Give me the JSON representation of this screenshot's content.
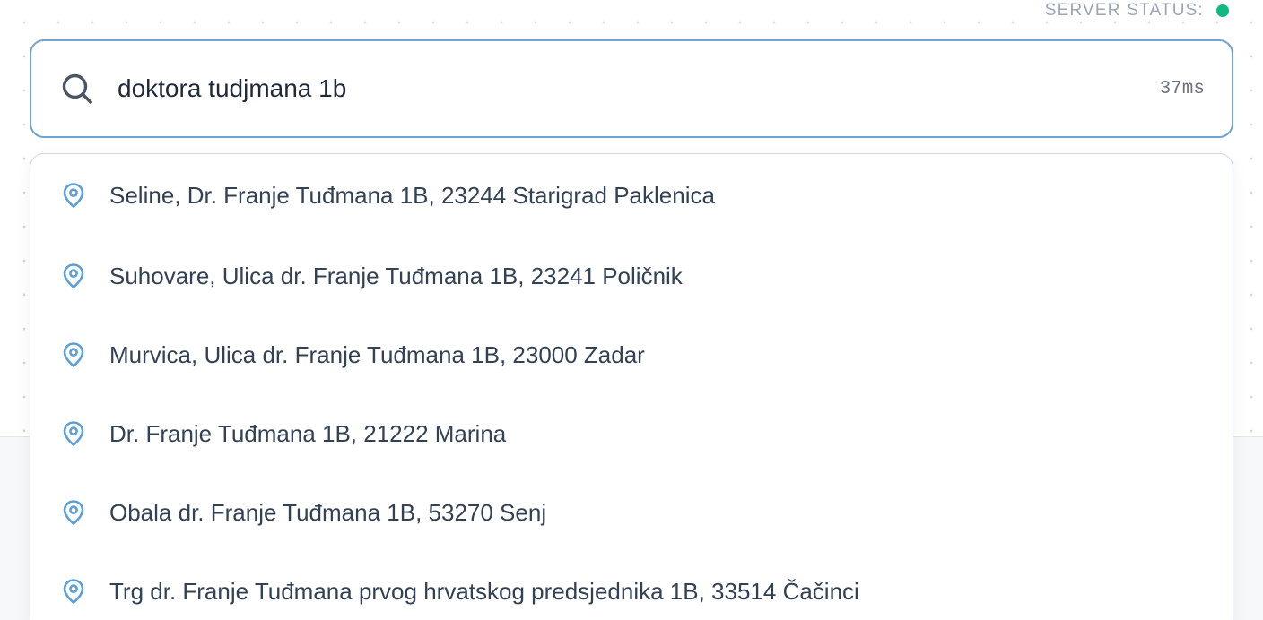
{
  "header": {
    "server_status_label": "SERVER STATUS:",
    "server_status_color": "#10b981"
  },
  "search": {
    "query": "doktora tudjmana 1b",
    "latency": "37ms",
    "icon": "search-icon",
    "border_color": "#6fa5d4"
  },
  "suggestions": {
    "icon": "map-pin-icon",
    "icon_color": "#5a9fd6",
    "items": [
      {
        "label": "Seline, Dr. Franje Tuđmana 1B, 23244 Starigrad Paklenica"
      },
      {
        "label": "Suhovare, Ulica dr. Franje Tuđmana 1B, 23241 Poličnik"
      },
      {
        "label": "Murvica, Ulica dr. Franje Tuđmana 1B, 23000 Zadar"
      },
      {
        "label": "Dr. Franje Tuđmana 1B, 21222 Marina"
      },
      {
        "label": "Obala dr. Franje Tuđmana 1B, 53270 Senj"
      },
      {
        "label": "Trg dr. Franje Tuđmana prvog hrvatskog predsjednika 1B, 33514 Čačinci"
      }
    ]
  }
}
